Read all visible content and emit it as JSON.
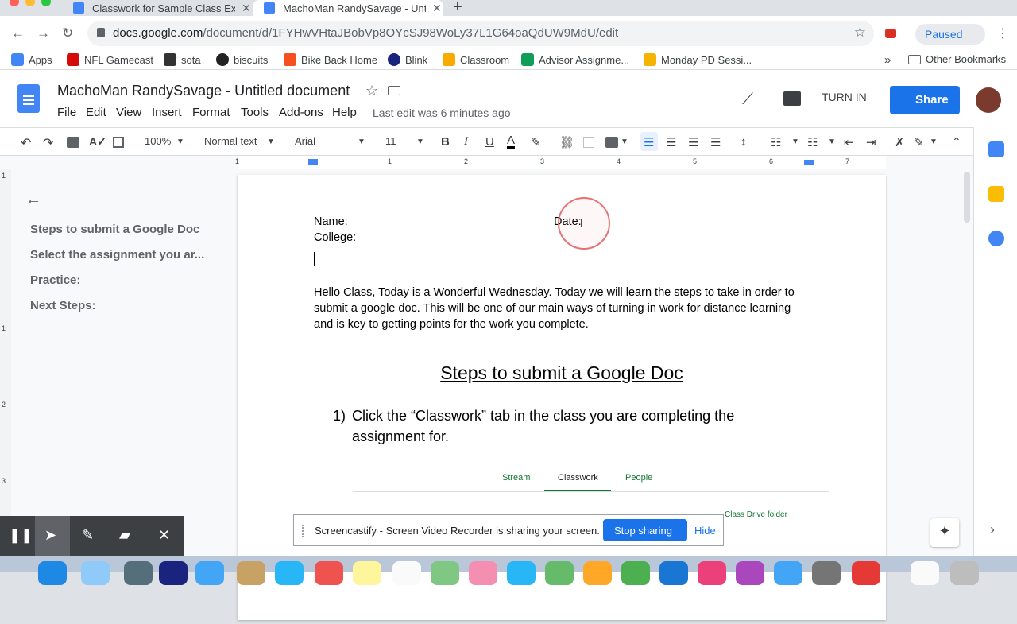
{
  "browser": {
    "tabs": [
      {
        "title": "Classwork for Sample Class Ex",
        "active": false
      },
      {
        "title": "MachoMan RandySavage - Unt",
        "active": true
      }
    ],
    "new_tab": "+",
    "close": "✕",
    "url_host": "docs.google.com",
    "url_path": "/document/d/1FYHwVHtaJBobVp8OYcSJ98WoLy37L1G64oaQdUW9MdU/edit",
    "profile_status": "Paused",
    "bookmarks": [
      {
        "label": "Apps",
        "color": "#4285f4"
      },
      {
        "label": "NFL Gamecast",
        "color": "#d50a0a"
      },
      {
        "label": "sota",
        "color": "#333333"
      },
      {
        "label": "biscuits",
        "color": "#222222"
      },
      {
        "label": "Bike Back Home",
        "color": "#f4511e"
      },
      {
        "label": "Blink",
        "color": "#1a237e"
      },
      {
        "label": "Classroom",
        "color": "#f9ab00"
      },
      {
        "label": "Advisor Assignme...",
        "color": "#0f9d58"
      },
      {
        "label": "Monday PD Sessi...",
        "color": "#f4b400"
      }
    ],
    "bookmarks_overflow": "»",
    "other_bookmarks": "Other Bookmarks"
  },
  "docs": {
    "title": "MachoMan RandySavage - Untitled document",
    "menus": [
      "File",
      "Edit",
      "View",
      "Insert",
      "Format",
      "Tools",
      "Add-ons",
      "Help"
    ],
    "last_edit": "Last edit was 6 minutes ago",
    "turn_in": "TURN IN",
    "share": "Share",
    "toolbar": {
      "zoom": "100%",
      "style": "Normal text",
      "font": "Arial",
      "size": "11"
    },
    "ruler_numbers": [
      "1",
      "1",
      "2",
      "3",
      "4",
      "5",
      "6",
      "7"
    ],
    "vruler_numbers": [
      "1",
      "1",
      "2",
      "3"
    ],
    "outline": [
      "Steps to submit a Google Doc",
      "Select the assignment you ar...",
      "Practice:",
      "Next Steps:"
    ],
    "document": {
      "name_label": "Name:",
      "date_label": "Date:",
      "college_label": "College:",
      "intro": "Hello Class, Today is a Wonderful Wednesday. Today we will learn the steps to take in order to submit a google doc. This will be one of our main ways of turning in work for distance learning and is key to getting points for the work you complete.",
      "heading": "Steps to submit a Google Doc",
      "step1_num": "1)",
      "step1_text": "Click the “Classwork” tab in the class you are completing the assignment for.",
      "embed_tabs": [
        "Stream",
        "Classwork",
        "People"
      ],
      "embed_folder": "Class Drive folder"
    }
  },
  "screencastify": {
    "message": "Screencastify - Screen Video Recorder is sharing your screen.",
    "stop": "Stop sharing",
    "hide": "Hide"
  },
  "colors": {
    "accent": "#1a73e8",
    "docs_blue": "#4285f4",
    "classroom_green": "#137333"
  }
}
